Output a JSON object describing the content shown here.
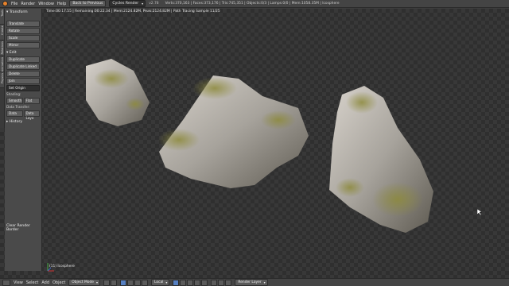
{
  "topbar": {
    "menus": [
      "File",
      "Render",
      "Window",
      "Help"
    ],
    "back_button": "Back to Previous",
    "render_engine": "Cycles Render",
    "version": "v2.78",
    "stats": "Verts:370,163 | Faces:373,176 | Tris:745,351 | Objects:0/3 | Lamps:0/0 | Mem:1058.35M | Icosphere"
  },
  "viewport": {
    "render_info": "Time:00:17.55 | Remaining:00:22.34 | Mem:2124.82M, Peak:2124.82M | Path Tracing Sample 11/25",
    "object_label": "(11) Icosphere"
  },
  "vtabs": [
    "Tools",
    "Create",
    "Relations",
    "Animation",
    "Physics"
  ],
  "toolpanel": {
    "transform_header": "Transform",
    "transform_buttons": [
      "Translate",
      "Rotate",
      "Scale",
      "Mirror"
    ],
    "edit_header": "Edit",
    "edit_buttons": [
      "Duplicate",
      "Duplicate Linked",
      "Delete",
      "Join"
    ],
    "set_origin": "Set Origin",
    "shading_label": "Shading:",
    "shading_buttons": [
      "Smooth",
      "Flat"
    ],
    "data_transfer_label": "Data Transfer:",
    "data_transfer_buttons": [
      "Data",
      "Data Layo"
    ],
    "history_header": "History",
    "clear_border": "Clear Render Border"
  },
  "bottombar": {
    "menus": [
      "View",
      "Select",
      "Add",
      "Object"
    ],
    "mode": "Object Mode",
    "pivot": "Local",
    "render_layer": "Render Layer"
  },
  "colors": {
    "accent": "#e8822b",
    "toggle_on": "#5680c2"
  }
}
